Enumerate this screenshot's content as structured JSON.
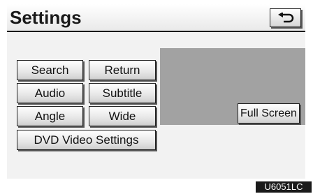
{
  "header": {
    "title": "Settings",
    "back_icon": "return-arrow-icon"
  },
  "buttons": {
    "search": "Search",
    "return": "Return",
    "audio": "Audio",
    "subtitle": "Subtitle",
    "angle": "Angle",
    "wide": "Wide",
    "dvd_video_settings": "DVD Video Settings"
  },
  "preview": {
    "full_screen": "Full Screen"
  },
  "figure_code": "U6051LC"
}
